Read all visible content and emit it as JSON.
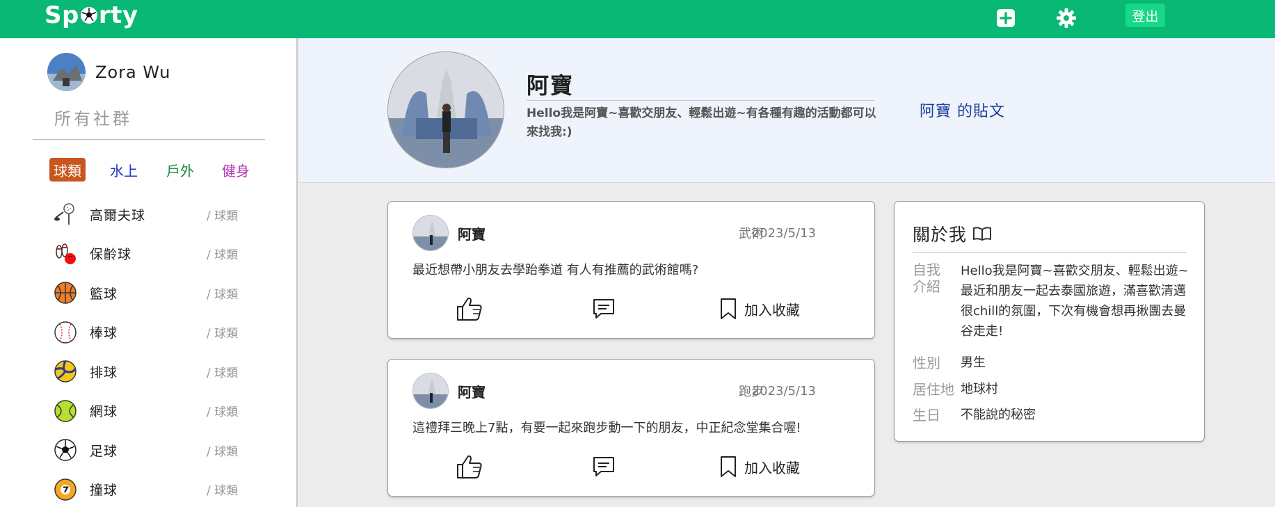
{
  "header": {
    "logo": "Sporty",
    "logout_label": "登出",
    "accent_color": "#08b874"
  },
  "sidebar": {
    "user_name": "Zora Wu",
    "all_groups": "所有社群",
    "categories": [
      {
        "label": "球類",
        "active": true,
        "color": "#c9561e"
      },
      {
        "label": "水上",
        "color": "#1a33c9"
      },
      {
        "label": "戶外",
        "color": "#198c3a"
      },
      {
        "label": "健身",
        "color": "#b32fb3"
      }
    ],
    "tag_prefix": "/",
    "sports": [
      {
        "name": "高爾夫球",
        "tag": "球類",
        "icon": "golf-icon"
      },
      {
        "name": "保齡球",
        "tag": "球類",
        "icon": "bowling-icon"
      },
      {
        "name": "籃球",
        "tag": "球類",
        "icon": "basketball-icon"
      },
      {
        "name": "棒球",
        "tag": "球類",
        "icon": "baseball-icon"
      },
      {
        "name": "排球",
        "tag": "球類",
        "icon": "volleyball-icon"
      },
      {
        "name": "網球",
        "tag": "球類",
        "icon": "tennis-icon"
      },
      {
        "name": "足球",
        "tag": "球類",
        "icon": "soccer-icon"
      },
      {
        "name": "撞球",
        "tag": "球類",
        "icon": "billiards-icon"
      }
    ]
  },
  "profile": {
    "name": "阿寶",
    "bio": "Hello我是阿寶~喜歡交朋友、輕鬆出遊~有各種有趣的活動都可以來找我:)",
    "posts_link": "阿寶 的貼文"
  },
  "posts": [
    {
      "author": "阿寶",
      "category": "武術",
      "date": "2023/5/13",
      "text": "最近想帶小朋友去學跆拳道 有人有推薦的武術館嗎?",
      "save_label": "加入收藏"
    },
    {
      "author": "阿寶",
      "category": "跑步",
      "date": "2023/5/13",
      "text": "這禮拜三晚上7點，有要一起來跑步動一下的朋友，中正紀念堂集合喔!",
      "save_label": "加入收藏"
    }
  ],
  "about": {
    "title": "關於我",
    "intro_label": "自我介紹",
    "intro": "Hello我是阿寶~喜歡交朋友、輕鬆出遊~最近和朋友一起去泰國旅遊，滿喜歡清邁很chill的氛圍，下次有機會想再揪團去曼谷走走!",
    "gender_label": "性別",
    "gender": "男生",
    "home_label": "居住地",
    "home": "地球村",
    "birthday_label": "生日",
    "birthday": "不能說的秘密"
  }
}
